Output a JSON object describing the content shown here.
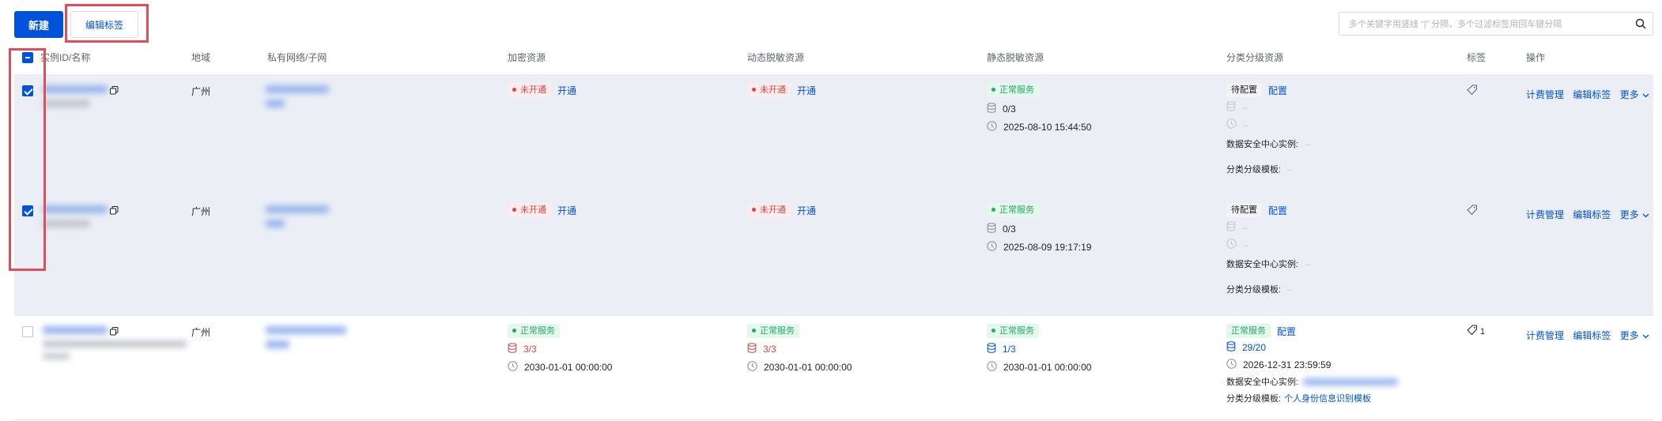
{
  "toolbar": {
    "create_label": "新建",
    "edit_tags_label": "编辑标签",
    "search_placeholder": "多个关键字用竖线 “|” 分隔，多个过滤标签用回车键分隔"
  },
  "table": {
    "columns": {
      "instance": "实例ID/名称",
      "region": "地域",
      "vpc": "私有网络/子网",
      "encrypt": "加密资源",
      "dynamic": "动态脱敏资源",
      "static": "静态脱敏资源",
      "classify": "分类分级资源",
      "tags": "标签",
      "ops": "操作"
    },
    "rows": [
      {
        "checked": true,
        "region": "广州",
        "encrypt": {
          "status": "未开通",
          "action": "开通"
        },
        "dynamic": {
          "status": "未开通",
          "action": "开通"
        },
        "static": {
          "status": "正常服务",
          "count": "0/3",
          "time": "2025-08-10 15:44:50"
        },
        "classify": {
          "status": "待配置",
          "action": "配置",
          "count": "–",
          "time": "–",
          "center_label": "数据安全中心实例:",
          "center_value": "–",
          "template_label": "分类分级模板:",
          "template_value": "–"
        },
        "tag_count": "",
        "ops": {
          "billing": "计费管理",
          "edit_tag": "编辑标签",
          "more": "更多"
        }
      },
      {
        "checked": true,
        "region": "广州",
        "encrypt": {
          "status": "未开通",
          "action": "开通"
        },
        "dynamic": {
          "status": "未开通",
          "action": "开通"
        },
        "static": {
          "status": "正常服务",
          "count": "0/3",
          "time": "2025-08-09 19:17:19"
        },
        "classify": {
          "status": "待配置",
          "action": "配置",
          "count": "–",
          "time": "–",
          "center_label": "数据安全中心实例:",
          "center_value": "–",
          "template_label": "分类分级模板:",
          "template_value": "–"
        },
        "tag_count": "",
        "ops": {
          "billing": "计费管理",
          "edit_tag": "编辑标签",
          "more": "更多"
        }
      },
      {
        "checked": false,
        "region": "广州",
        "encrypt": {
          "status": "正常服务",
          "count": "3/3",
          "time": "2030-01-01 00:00:00"
        },
        "dynamic": {
          "status": "正常服务",
          "count": "3/3",
          "time": "2030-01-01 00:00:00"
        },
        "static": {
          "status": "正常服务",
          "count": "1/3",
          "time": "2030-01-01 00:00:00"
        },
        "classify": {
          "status": "正常服务",
          "action": "配置",
          "count": "29/20",
          "time": "2026-12-31 23:59:59",
          "center_label": "数据安全中心实例:",
          "template_label": "分类分级模板:",
          "template_value": "个人身份信息识别模板"
        },
        "tag_count": "1",
        "ops": {
          "billing": "计费管理",
          "edit_tag": "编辑标签",
          "more": "更多"
        }
      }
    ]
  },
  "colors": {
    "primary": "#0052d9",
    "error": "#d54941",
    "success": "#2ba471",
    "highlight": "#e34d59"
  }
}
